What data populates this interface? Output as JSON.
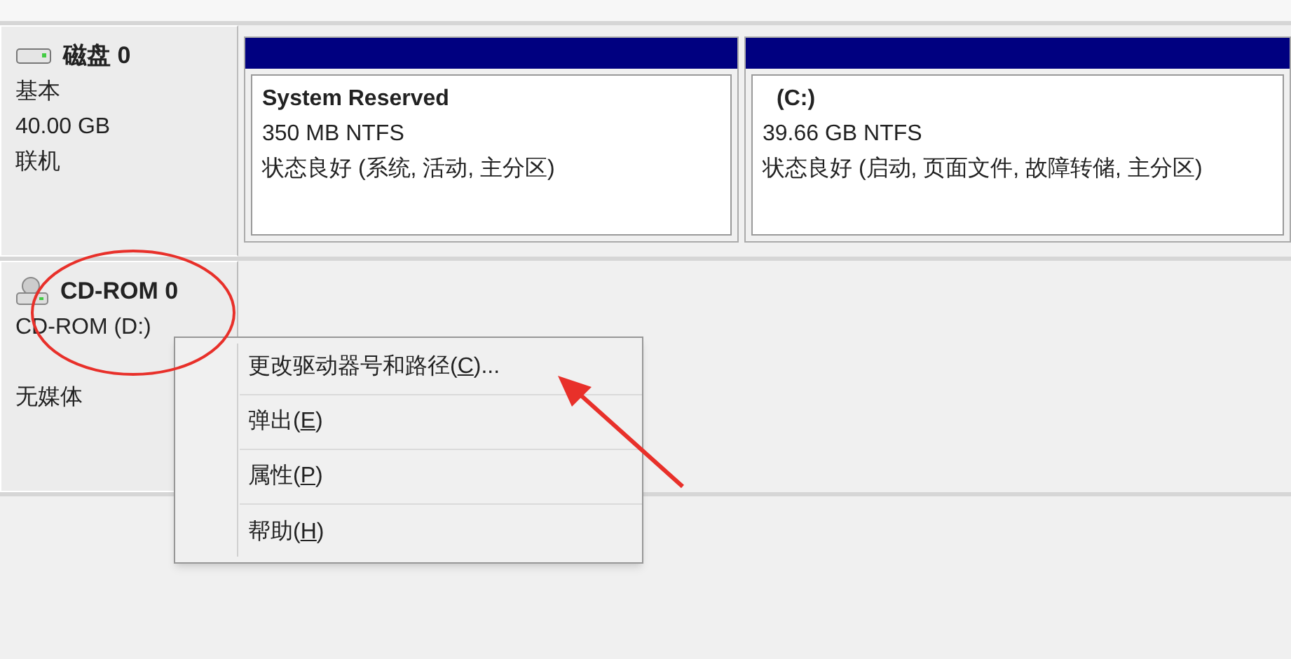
{
  "disks": [
    {
      "kind": "basic",
      "name": "磁盘 0",
      "lines": [
        "基本",
        "40.00 GB",
        "联机"
      ],
      "partitions": [
        {
          "title": "System Reserved",
          "size": "350 MB NTFS",
          "status": "状态良好 (系统, 活动, 主分区)"
        },
        {
          "title": "(C:)",
          "size": "39.66 GB NTFS",
          "status": "状态良好 (启动, 页面文件, 故障转储, 主分区)"
        }
      ]
    },
    {
      "kind": "cdrom",
      "name": "CD-ROM 0",
      "lines": [
        "CD-ROM (D:)"
      ],
      "media": "无媒体"
    }
  ],
  "context_menu": [
    {
      "before": "更改驱动器号和路径(",
      "key": "C",
      "after": ")..."
    },
    {
      "before": "弹出(",
      "key": "E",
      "after": ")"
    },
    {
      "before": "属性(",
      "key": "P",
      "after": ")"
    },
    {
      "before": "帮助(",
      "key": "H",
      "after": ")"
    }
  ]
}
